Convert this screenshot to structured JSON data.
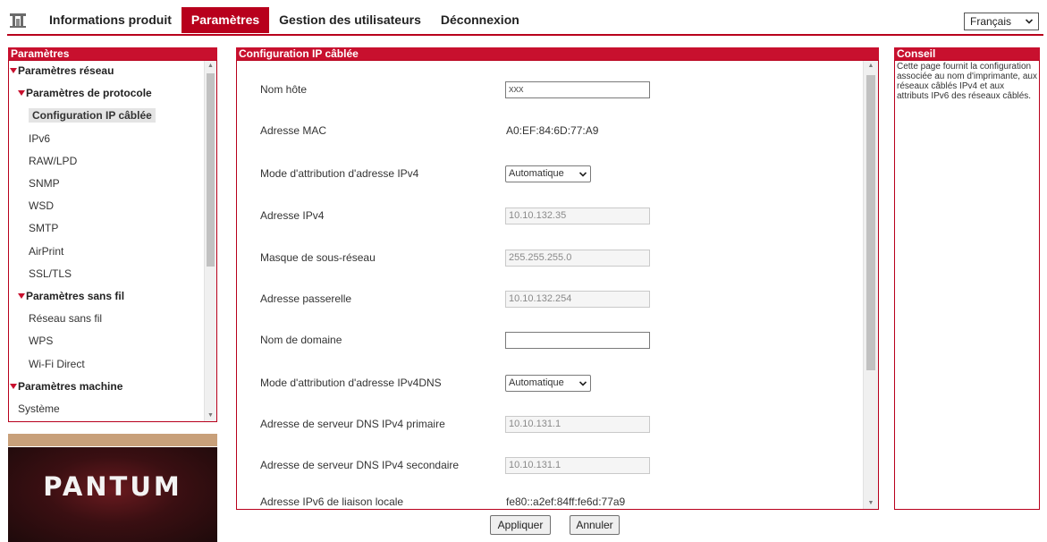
{
  "nav": {
    "items": [
      "Informations produit",
      "Paramètres",
      "Gestion des utilisateurs",
      "Déconnexion"
    ],
    "active_index": 1
  },
  "language": {
    "selected": "Français"
  },
  "left_panel": {
    "title": "Paramètres",
    "tree": [
      {
        "label": "Paramètres réseau",
        "level": 0,
        "type": "group"
      },
      {
        "label": "Paramètres de protocole",
        "level": 1,
        "type": "group"
      },
      {
        "label": "Configuration IP câblée",
        "level": 2,
        "type": "item",
        "selected": true
      },
      {
        "label": "IPv6",
        "level": 2,
        "type": "item"
      },
      {
        "label": "RAW/LPD",
        "level": 2,
        "type": "item"
      },
      {
        "label": "SNMP",
        "level": 2,
        "type": "item"
      },
      {
        "label": "WSD",
        "level": 2,
        "type": "item"
      },
      {
        "label": "SMTP",
        "level": 2,
        "type": "item"
      },
      {
        "label": "AirPrint",
        "level": 2,
        "type": "item"
      },
      {
        "label": "SSL/TLS",
        "level": 2,
        "type": "item"
      },
      {
        "label": "Paramètres sans fil",
        "level": 1,
        "type": "group"
      },
      {
        "label": "Réseau sans fil",
        "level": 2,
        "type": "item"
      },
      {
        "label": "WPS",
        "level": 2,
        "type": "item"
      },
      {
        "label": "Wi-Fi Direct",
        "level": 2,
        "type": "item"
      },
      {
        "label": "Paramètres machine",
        "level": 0,
        "type": "group"
      },
      {
        "label": "Système",
        "level": 1,
        "type": "item"
      }
    ]
  },
  "logo": {
    "text": "PANTUM"
  },
  "main_panel": {
    "title": "Configuration IP câblée",
    "fields": [
      {
        "label": "Nom hôte",
        "kind": "input",
        "value": "xxx",
        "disabled": false
      },
      {
        "label": "Adresse MAC",
        "kind": "text",
        "value": "A0:EF:84:6D:77:A9"
      },
      {
        "label": "Mode d'attribution d'adresse IPv4",
        "kind": "select",
        "value": "Automatique"
      },
      {
        "label": "Adresse IPv4",
        "kind": "input",
        "value": "10.10.132.35",
        "disabled": true
      },
      {
        "label": "Masque de sous-réseau",
        "kind": "input",
        "value": "255.255.255.0",
        "disabled": true
      },
      {
        "label": "Adresse passerelle",
        "kind": "input",
        "value": "10.10.132.254",
        "disabled": true
      },
      {
        "label": "Nom de domaine",
        "kind": "input",
        "value": "",
        "disabled": false
      },
      {
        "label": "Mode d'attribution d'adresse IPv4DNS",
        "kind": "select",
        "value": "Automatique"
      },
      {
        "label": "Adresse de serveur DNS IPv4 primaire",
        "kind": "input",
        "value": "10.10.131.1",
        "disabled": true
      },
      {
        "label": "Adresse de serveur DNS IPv4 secondaire",
        "kind": "input",
        "value": "10.10.131.1",
        "disabled": true
      },
      {
        "label": "Adresse IPv6 de liaison locale",
        "kind": "text",
        "value": "fe80::a2ef:84ff:fe6d:77a9"
      }
    ],
    "apply_label": "Appliquer",
    "cancel_label": "Annuler"
  },
  "right_panel": {
    "title": "Conseil",
    "text": "Cette page fournit la configuration associée au nom d'imprimante, aux réseaux câblés IPv4 et aux attributs IPv6 des réseaux câblés."
  },
  "colors": {
    "accent": "#c8102e",
    "border": "#b8001c"
  }
}
